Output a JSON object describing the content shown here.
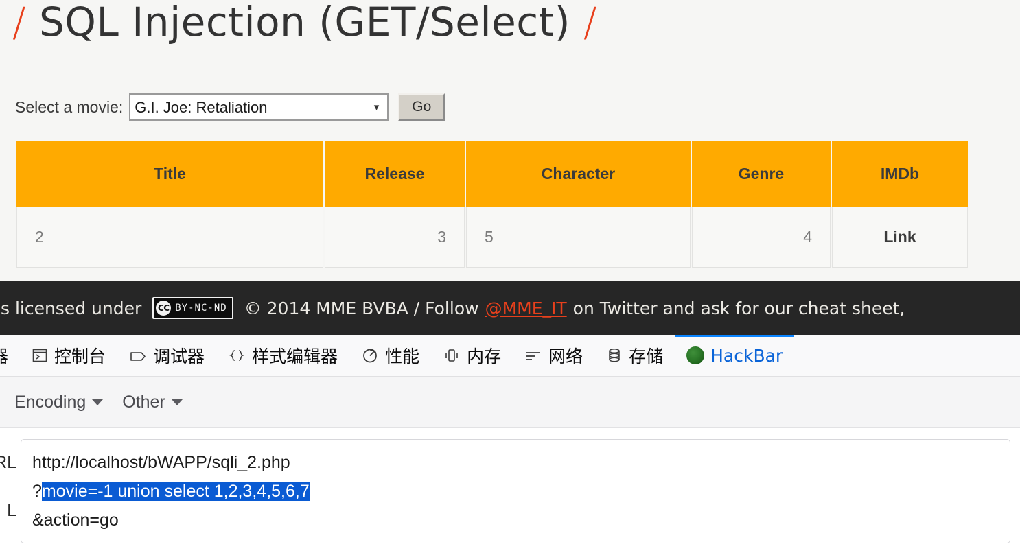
{
  "page": {
    "title_prefix": "/",
    "title_text": "SQL Injection (GET/Select)",
    "title_suffix": "/",
    "form": {
      "label": "Select a movie:",
      "selected_movie": "G.I. Joe: Retaliation",
      "dropdown_arrow": "chevron-down-icon",
      "go_label": "Go"
    },
    "table": {
      "columns": [
        "Title",
        "Release",
        "Character",
        "Genre",
        "IMDb"
      ],
      "rows": [
        {
          "title": "2",
          "release": "3",
          "character": "5",
          "genre": "4",
          "imdb": "Link"
        }
      ]
    },
    "footer": {
      "text_before": "P is licensed under",
      "cc_mark": "CC",
      "cc_license": "BY-NC-ND",
      "text_middle": "© 2014 MME BVBA / Follow",
      "twitter_handle": "@MME_IT",
      "text_after": "on Twitter and ask for our cheat sheet,"
    }
  },
  "devtools": {
    "tabs": [
      {
        "label": "器",
        "icon": "inspector-icon",
        "active": false
      },
      {
        "label": "控制台",
        "icon": "console-icon",
        "active": false
      },
      {
        "label": "调试器",
        "icon": "debugger-icon",
        "active": false
      },
      {
        "label": "样式编辑器",
        "icon": "style-editor-icon",
        "active": false
      },
      {
        "label": "性能",
        "icon": "performance-icon",
        "active": false
      },
      {
        "label": "内存",
        "icon": "memory-icon",
        "active": false
      },
      {
        "label": "网络",
        "icon": "network-icon",
        "active": false
      },
      {
        "label": "存储",
        "icon": "storage-icon",
        "active": false
      },
      {
        "label": "HackBar",
        "icon": "hackbar-icon",
        "active": true
      }
    ],
    "active_tab_color": "#0a84ff"
  },
  "hackbar": {
    "menus": [
      {
        "label": "",
        "caret": "chevron-down-icon"
      },
      {
        "label": "Encoding",
        "caret": "chevron-down-icon"
      },
      {
        "label": "Other",
        "caret": "chevron-down-icon"
      }
    ],
    "url_label": "RL",
    "sql_label": "L",
    "url_line1": "http://localhost/bWAPP/sqli_2.php",
    "url_line2_prefix": "?",
    "url_line2_selected": "movie=-1 union select 1,2,3,4,5,6,7",
    "url_line3": "&action=go",
    "selection_color": "#0a5bd3"
  }
}
